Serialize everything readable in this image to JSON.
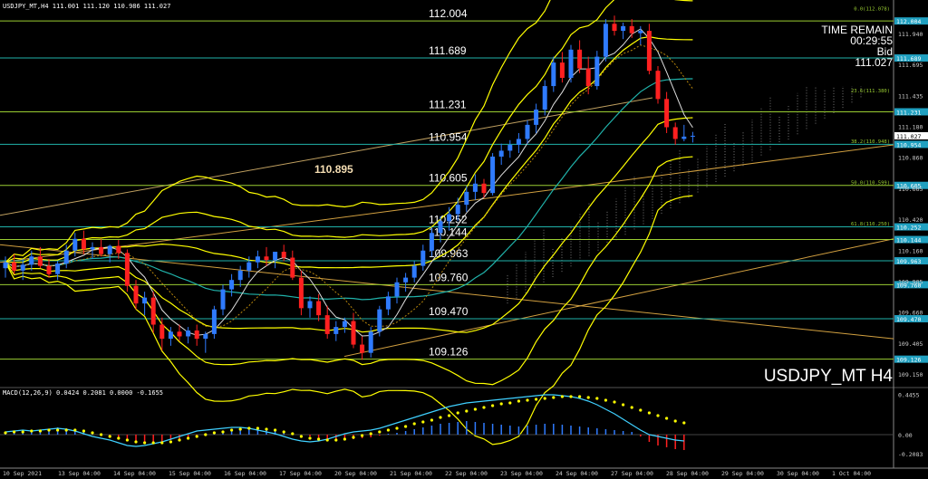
{
  "header": {
    "symbol_line": "USDJPY_MT,H4   111.001 111.120 110.986 111.027",
    "macd_label": "MACD(12,26,9) 0.0424 0.2081 0.0000 -0.1655"
  },
  "info": {
    "time_remain_label": "TIME REMAIN",
    "time_remain": "00:29:55",
    "bid_label": "Bid",
    "bid": "111.027",
    "watermark": "USDJPY_MT H4",
    "callout": "110.895"
  },
  "colors": {
    "bull": "#2f7bff",
    "bear": "#ff2020",
    "band": "#ffff00",
    "level": "#9acd32",
    "teal": "#20b2aa",
    "macd_line": "#3fd0ff",
    "signal": "#ffff00"
  },
  "chart_data": {
    "type": "candlestick",
    "ylim": [
      108.9,
      112.09
    ],
    "y_ticks": [
      "111.940",
      "111.695",
      "111.435",
      "111.180",
      "110.860",
      "110.665",
      "110.420",
      "110.160",
      "109.905",
      "109.660",
      "109.405",
      "109.150"
    ],
    "x_ticks": [
      "10 Sep 2021",
      "13 Sep 04:00",
      "14 Sep 04:00",
      "15 Sep 04:00",
      "16 Sep 04:00",
      "17 Sep 04:00",
      "20 Sep 04:00",
      "21 Sep 04:00",
      "22 Sep 04:00",
      "23 Sep 04:00",
      "24 Sep 04:00",
      "27 Sep 04:00",
      "28 Sep 04:00",
      "29 Sep 04:00",
      "30 Sep 04:00",
      "1 Oct 04:00"
    ],
    "levels": [
      {
        "label": "112.004",
        "value": 112.004,
        "tag": "112.004"
      },
      {
        "label": "111.689",
        "value": 111.689,
        "tag": "111.689"
      },
      {
        "label": "111.231",
        "value": 111.231,
        "tag": "111.231"
      },
      {
        "label": "110.954",
        "value": 110.954,
        "tag": "110.954"
      },
      {
        "label": "110.605",
        "value": 110.605,
        "tag": "110.605"
      },
      {
        "label": "110.252",
        "value": 110.252,
        "tag": "110.252"
      },
      {
        "label": "110.144",
        "value": 110.144,
        "tag": "110.144"
      },
      {
        "label": "109.963",
        "value": 109.963,
        "tag": "109.963"
      },
      {
        "label": "109.760",
        "value": 109.76,
        "tag": "109.760"
      },
      {
        "label": "109.470",
        "value": 109.47,
        "tag": "109.470"
      },
      {
        "label": "109.126",
        "value": 109.126,
        "tag": "109.126"
      }
    ],
    "fib_labels": [
      {
        "text": "0.0(112.078)",
        "value": 112.078
      },
      {
        "text": "23.6(111.380)",
        "value": 111.38
      },
      {
        "text": "38.2(110.948)",
        "value": 110.948
      },
      {
        "text": "50.0(110.599)",
        "value": 110.599
      },
      {
        "text": "61.8(110.250)",
        "value": 110.25
      }
    ],
    "current_price": {
      "tag": "111.027",
      "value": 111.027
    },
    "macd": {
      "ylim": [
        -0.3,
        0.5
      ],
      "ticks": [
        {
          "label": "0.4455",
          "value": 0.4455
        },
        {
          "label": "0.00",
          "value": 0.0
        },
        {
          "label": "-0.2083",
          "value": -0.2083
        }
      ],
      "histogram": [
        0.02,
        0.03,
        0.04,
        0.03,
        0.05,
        0.06,
        0.08,
        0.07,
        0.05,
        0.03,
        0.01,
        -0.01,
        -0.03,
        -0.05,
        -0.07,
        -0.09,
        -0.1,
        -0.09,
        -0.08,
        -0.06,
        -0.05,
        -0.04,
        -0.02,
        0.0,
        0.02,
        0.04,
        0.05,
        0.07,
        0.08,
        0.07,
        0.06,
        0.05,
        0.04,
        0.02,
        0.0,
        -0.02,
        -0.04,
        -0.05,
        -0.06,
        -0.06,
        -0.05,
        -0.04,
        -0.03,
        -0.01,
        0.01,
        0.02,
        0.04,
        0.06,
        0.08,
        0.1,
        0.12,
        0.13,
        0.14,
        0.15,
        0.14,
        0.13,
        0.12,
        0.11,
        0.1,
        0.09,
        0.1,
        0.11,
        0.12,
        0.12,
        0.11,
        0.1,
        0.09,
        0.08,
        0.07,
        0.06,
        0.05,
        0.04,
        0.03,
        -0.02,
        -0.08,
        -0.12,
        -0.14,
        -0.16,
        -0.17
      ],
      "macd_line": [
        0.03,
        0.04,
        0.05,
        0.04,
        0.05,
        0.06,
        0.07,
        0.06,
        0.04,
        0.01,
        -0.02,
        -0.04,
        -0.06,
        -0.09,
        -0.12,
        -0.13,
        -0.12,
        -0.1,
        -0.08,
        -0.05,
        -0.02,
        0.01,
        0.04,
        0.05,
        0.06,
        0.07,
        0.08,
        0.08,
        0.07,
        0.05,
        0.03,
        0.01,
        -0.02,
        -0.05,
        -0.07,
        -0.08,
        -0.07,
        -0.05,
        -0.02,
        0.01,
        0.03,
        0.04,
        0.05,
        0.07,
        0.1,
        0.13,
        0.16,
        0.19,
        0.22,
        0.25,
        0.28,
        0.31,
        0.33,
        0.35,
        0.36,
        0.37,
        0.38,
        0.39,
        0.4,
        0.41,
        0.42,
        0.43,
        0.44,
        0.44,
        0.43,
        0.42,
        0.4,
        0.37,
        0.33,
        0.28,
        0.23,
        0.17,
        0.11,
        0.05,
        0.0,
        -0.02,
        -0.04,
        -0.06,
        -0.07
      ],
      "signal_line": [
        0.02,
        0.03,
        0.03,
        0.04,
        0.04,
        0.05,
        0.05,
        0.05,
        0.05,
        0.04,
        0.02,
        0.0,
        -0.02,
        -0.04,
        -0.06,
        -0.08,
        -0.09,
        -0.09,
        -0.09,
        -0.08,
        -0.06,
        -0.04,
        -0.02,
        0.0,
        0.02,
        0.03,
        0.05,
        0.06,
        0.07,
        0.07,
        0.06,
        0.05,
        0.03,
        0.01,
        -0.02,
        -0.04,
        -0.05,
        -0.06,
        -0.06,
        -0.05,
        -0.03,
        -0.01,
        0.01,
        0.03,
        0.05,
        0.07,
        0.09,
        0.12,
        0.14,
        0.16,
        0.19,
        0.21,
        0.24,
        0.26,
        0.28,
        0.3,
        0.32,
        0.34,
        0.35,
        0.37,
        0.38,
        0.39,
        0.4,
        0.41,
        0.42,
        0.42,
        0.42,
        0.41,
        0.4,
        0.38,
        0.36,
        0.33,
        0.3,
        0.27,
        0.24,
        0.21,
        0.18,
        0.15,
        0.13
      ]
    },
    "candles": [
      [
        109.9,
        110.0,
        109.82,
        109.95
      ],
      [
        109.95,
        110.02,
        109.85,
        109.88
      ],
      [
        109.88,
        109.98,
        109.8,
        109.93
      ],
      [
        109.93,
        110.05,
        109.88,
        110.0
      ],
      [
        110.0,
        110.08,
        109.9,
        109.92
      ],
      [
        109.92,
        109.98,
        109.82,
        109.85
      ],
      [
        109.85,
        109.96,
        109.8,
        109.94
      ],
      [
        109.94,
        110.1,
        109.9,
        110.05
      ],
      [
        110.05,
        110.2,
        110.0,
        110.15
      ],
      [
        110.15,
        110.22,
        110.02,
        110.06
      ],
      [
        110.06,
        110.12,
        109.98,
        110.08
      ],
      [
        110.08,
        110.15,
        110.0,
        110.02
      ],
      [
        110.02,
        110.1,
        109.95,
        110.09
      ],
      [
        110.09,
        110.14,
        109.98,
        110.03
      ],
      [
        110.03,
        110.06,
        109.7,
        109.75
      ],
      [
        109.75,
        109.8,
        109.55,
        109.6
      ],
      [
        109.6,
        109.7,
        109.5,
        109.65
      ],
      [
        109.65,
        109.7,
        109.35,
        109.42
      ],
      [
        109.42,
        109.48,
        109.2,
        109.3
      ],
      [
        109.3,
        109.4,
        109.24,
        109.36
      ],
      [
        109.36,
        109.42,
        109.28,
        109.32
      ],
      [
        109.32,
        109.4,
        109.26,
        109.37
      ],
      [
        109.37,
        109.42,
        109.24,
        109.3
      ],
      [
        109.3,
        109.36,
        109.18,
        109.34
      ],
      [
        109.34,
        109.58,
        109.3,
        109.55
      ],
      [
        109.55,
        109.76,
        109.5,
        109.72
      ],
      [
        109.72,
        109.85,
        109.66,
        109.8
      ],
      [
        109.8,
        109.92,
        109.74,
        109.88
      ],
      [
        109.88,
        110.0,
        109.82,
        109.95
      ],
      [
        109.95,
        110.05,
        109.9,
        110.0
      ],
      [
        110.0,
        110.08,
        109.92,
        109.97
      ],
      [
        109.97,
        110.02,
        109.9,
        110.04
      ],
      [
        110.04,
        110.1,
        109.96,
        109.99
      ],
      [
        109.99,
        110.05,
        109.8,
        109.82
      ],
      [
        109.82,
        109.88,
        109.5,
        109.56
      ],
      [
        109.56,
        109.66,
        109.48,
        109.62
      ],
      [
        109.62,
        109.68,
        109.45,
        109.5
      ],
      [
        109.5,
        109.58,
        109.3,
        109.34
      ],
      [
        109.34,
        109.45,
        109.28,
        109.4
      ],
      [
        109.4,
        109.48,
        109.35,
        109.45
      ],
      [
        109.45,
        109.52,
        109.22,
        109.25
      ],
      [
        109.25,
        109.32,
        109.12,
        109.18
      ],
      [
        109.18,
        109.4,
        109.14,
        109.36
      ],
      [
        109.36,
        109.58,
        109.32,
        109.55
      ],
      [
        109.55,
        109.7,
        109.5,
        109.66
      ],
      [
        109.66,
        109.82,
        109.6,
        109.78
      ],
      [
        109.78,
        109.86,
        109.7,
        109.82
      ],
      [
        109.82,
        109.96,
        109.78,
        109.92
      ],
      [
        109.92,
        110.1,
        109.88,
        110.05
      ],
      [
        110.05,
        110.25,
        110.0,
        110.2
      ],
      [
        110.2,
        110.34,
        110.12,
        110.3
      ],
      [
        110.3,
        110.42,
        110.22,
        110.36
      ],
      [
        110.36,
        110.5,
        110.3,
        110.44
      ],
      [
        110.44,
        110.6,
        110.38,
        110.55
      ],
      [
        110.55,
        110.7,
        110.48,
        110.62
      ],
      [
        110.62,
        110.66,
        110.5,
        110.54
      ],
      [
        110.54,
        110.88,
        110.52,
        110.85
      ],
      [
        110.85,
        110.96,
        110.78,
        110.9
      ],
      [
        110.9,
        110.99,
        110.84,
        110.95
      ],
      [
        110.95,
        111.05,
        110.88,
        111.0
      ],
      [
        111.0,
        111.16,
        110.96,
        111.12
      ],
      [
        111.12,
        111.3,
        111.05,
        111.25
      ],
      [
        111.25,
        111.5,
        111.2,
        111.45
      ],
      [
        111.45,
        111.7,
        111.4,
        111.65
      ],
      [
        111.65,
        111.74,
        111.48,
        111.52
      ],
      [
        111.52,
        111.8,
        111.48,
        111.76
      ],
      [
        111.76,
        111.84,
        111.56,
        111.6
      ],
      [
        111.6,
        111.7,
        111.38,
        111.45
      ],
      [
        111.45,
        111.75,
        111.42,
        111.7
      ],
      [
        111.7,
        112.02,
        111.66,
        111.98
      ],
      [
        111.98,
        112.05,
        111.88,
        111.92
      ],
      [
        111.92,
        111.99,
        111.85,
        111.96
      ],
      [
        111.96,
        112.02,
        111.86,
        111.9
      ],
      [
        111.9,
        111.96,
        111.8,
        111.92
      ],
      [
        111.92,
        111.98,
        111.55,
        111.58
      ],
      [
        111.58,
        111.62,
        111.3,
        111.34
      ],
      [
        111.34,
        111.4,
        111.05,
        111.1
      ],
      [
        111.1,
        111.14,
        110.95,
        111.0
      ],
      [
        111.0,
        111.12,
        110.98,
        111.02
      ],
      [
        111.02,
        111.06,
        110.97,
        111.027
      ]
    ]
  }
}
